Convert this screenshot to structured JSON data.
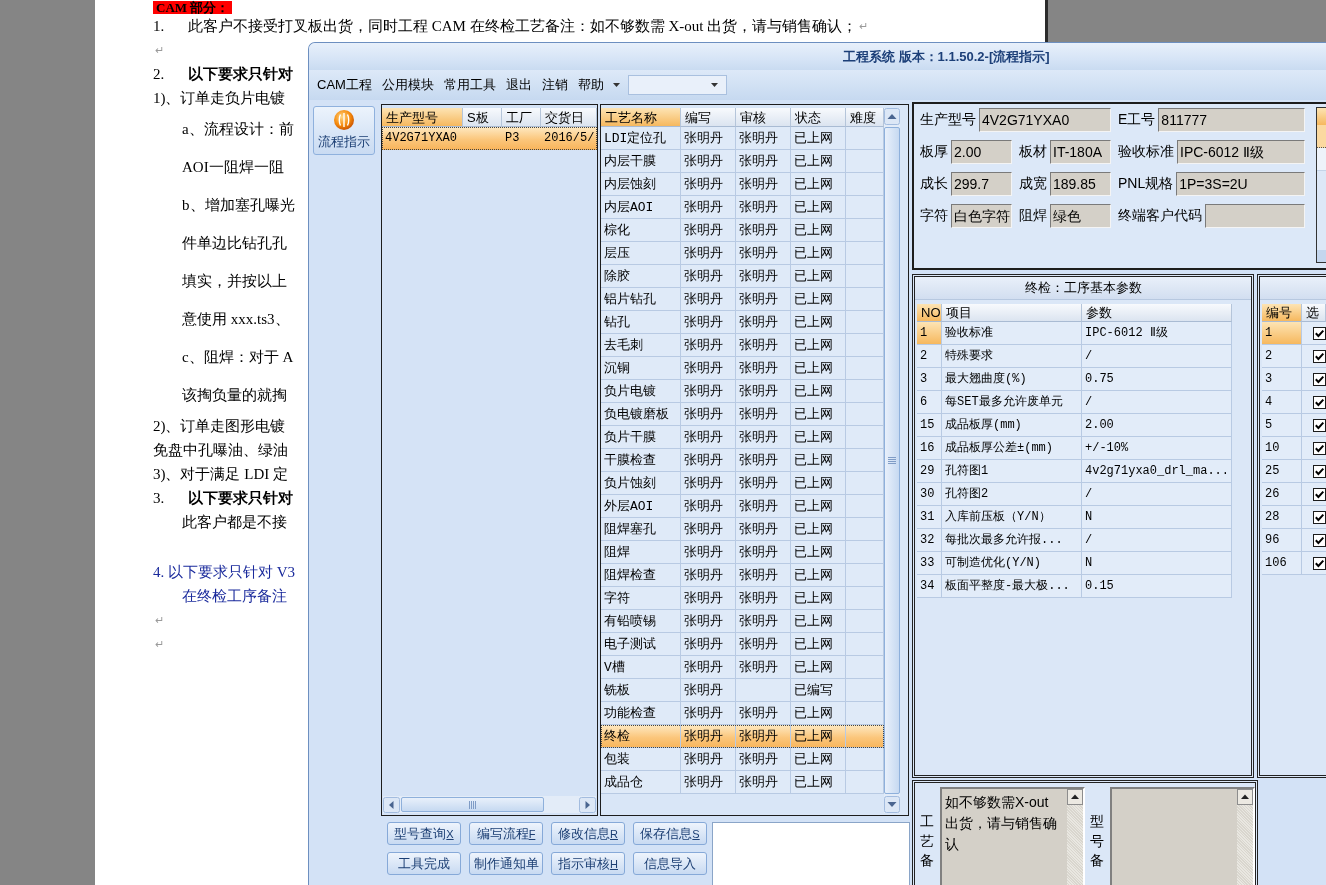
{
  "document": {
    "lines": [
      {
        "kind": "heading",
        "text": "CAM 部分："
      },
      {
        "kind": "item",
        "number": "1.",
        "text": "此客户不接受打叉板出货，同时工程 CAM 在终检工艺备注：如不够数需 X-out 出货，请与销售确认；",
        "bold": false,
        "mark": "↵"
      },
      {
        "kind": "mark",
        "mark": "↵"
      },
      {
        "kind": "item",
        "number": "2.",
        "text": "以下要求只针对",
        "bold": true
      },
      {
        "kind": "line",
        "text": "1)、订单走负片电镀"
      },
      {
        "kind": "indent",
        "text": "a、流程设计：前"
      },
      {
        "kind": "indent",
        "text": "AOI一阻焊一阻"
      },
      {
        "kind": "indent",
        "text": "b、增加塞孔曝光"
      },
      {
        "kind": "indent",
        "text": "件单边比钻孔孔"
      },
      {
        "kind": "indent",
        "text": "填实，并按以上"
      },
      {
        "kind": "indent",
        "text": "意使用 xxx.ts3、"
      },
      {
        "kind": "indent",
        "text": "c、阻焊：对于 A"
      },
      {
        "kind": "indent",
        "text": "该掏负量的就掏"
      },
      {
        "kind": "line",
        "text": "2)、订单走图形电镀"
      },
      {
        "kind": "line",
        "text": "免盘中孔曝油、绿油"
      },
      {
        "kind": "line",
        "text": "3)、对于满足 LDI 定"
      },
      {
        "kind": "item",
        "number": "3.",
        "text": "以下要求只针对",
        "bold": true
      },
      {
        "kind": "indent-tight",
        "text": "此客户都是不接"
      },
      {
        "kind": "line-spaced",
        "text": "4. 以下要求只针对 V3",
        "color": "#1a2a9c"
      },
      {
        "kind": "indent-tight",
        "text": "在终检工序备注",
        "color": "#1a2a9c"
      },
      {
        "kind": "mark",
        "mark": "↵"
      },
      {
        "kind": "mark",
        "mark": "↵"
      }
    ]
  },
  "window": {
    "title": "工程系统 版本：1.1.50.2-[流程指示]"
  },
  "menu": {
    "items": [
      "CAM工程",
      "公用模块",
      "常用工具",
      "退出",
      "注销",
      "帮助"
    ]
  },
  "sidebar": {
    "buttons": [
      {
        "label": "流程指示"
      }
    ]
  },
  "orders": {
    "columns": [
      {
        "label": "生产型号",
        "selected": true
      },
      {
        "label": "S板",
        "selected": false
      },
      {
        "label": "工厂",
        "selected": false
      },
      {
        "label": "交货日",
        "selected": false
      }
    ],
    "rows": [
      {
        "model": "4V2G71YXA0",
        "factory": "P3",
        "delivery_date": "2016/5/",
        "selected": true
      }
    ]
  },
  "processes": {
    "columns": [
      {
        "label": "工艺名称",
        "selected": true
      },
      {
        "label": "编写",
        "selected": false
      },
      {
        "label": "审核",
        "selected": false
      },
      {
        "label": "状态",
        "selected": false
      },
      {
        "label": "难度",
        "selected": false
      }
    ],
    "rows": [
      {
        "name": "LDI定位孔",
        "writer": "张明丹",
        "reviewer": "张明丹",
        "status": "已上网",
        "selected": false
      },
      {
        "name": "内层干膜",
        "writer": "张明丹",
        "reviewer": "张明丹",
        "status": "已上网",
        "selected": false
      },
      {
        "name": "内层蚀刻",
        "writer": "张明丹",
        "reviewer": "张明丹",
        "status": "已上网",
        "selected": false
      },
      {
        "name": "内层AOI",
        "writer": "张明丹",
        "reviewer": "张明丹",
        "status": "已上网",
        "selected": false
      },
      {
        "name": "棕化",
        "writer": "张明丹",
        "reviewer": "张明丹",
        "status": "已上网",
        "selected": false
      },
      {
        "name": "层压",
        "writer": "张明丹",
        "reviewer": "张明丹",
        "status": "已上网",
        "selected": false
      },
      {
        "name": "除胶",
        "writer": "张明丹",
        "reviewer": "张明丹",
        "status": "已上网",
        "selected": false
      },
      {
        "name": "铝片钻孔",
        "writer": "张明丹",
        "reviewer": "张明丹",
        "status": "已上网",
        "selected": false
      },
      {
        "name": "钻孔",
        "writer": "张明丹",
        "reviewer": "张明丹",
        "status": "已上网",
        "selected": false
      },
      {
        "name": "去毛刺",
        "writer": "张明丹",
        "reviewer": "张明丹",
        "status": "已上网",
        "selected": false
      },
      {
        "name": "沉铜",
        "writer": "张明丹",
        "reviewer": "张明丹",
        "status": "已上网",
        "selected": false
      },
      {
        "name": "负片电镀",
        "writer": "张明丹",
        "reviewer": "张明丹",
        "status": "已上网",
        "selected": false
      },
      {
        "name": "负电镀磨板",
        "writer": "张明丹",
        "reviewer": "张明丹",
        "status": "已上网",
        "selected": false
      },
      {
        "name": "负片干膜",
        "writer": "张明丹",
        "reviewer": "张明丹",
        "status": "已上网",
        "selected": false
      },
      {
        "name": "干膜检查",
        "writer": "张明丹",
        "reviewer": "张明丹",
        "status": "已上网",
        "selected": false
      },
      {
        "name": "负片蚀刻",
        "writer": "张明丹",
        "reviewer": "张明丹",
        "status": "已上网",
        "selected": false
      },
      {
        "name": "外层AOI",
        "writer": "张明丹",
        "reviewer": "张明丹",
        "status": "已上网",
        "selected": false
      },
      {
        "name": "阻焊塞孔",
        "writer": "张明丹",
        "reviewer": "张明丹",
        "status": "已上网",
        "selected": false
      },
      {
        "name": "阻焊",
        "writer": "张明丹",
        "reviewer": "张明丹",
        "status": "已上网",
        "selected": false
      },
      {
        "name": "阻焊检查",
        "writer": "张明丹",
        "reviewer": "张明丹",
        "status": "已上网",
        "selected": false
      },
      {
        "name": "字符",
        "writer": "张明丹",
        "reviewer": "张明丹",
        "status": "已上网",
        "selected": false
      },
      {
        "name": "有铅喷锡",
        "writer": "张明丹",
        "reviewer": "张明丹",
        "status": "已上网",
        "selected": false
      },
      {
        "name": "电子测试",
        "writer": "张明丹",
        "reviewer": "张明丹",
        "status": "已上网",
        "selected": false
      },
      {
        "name": "V槽",
        "writer": "张明丹",
        "reviewer": "张明丹",
        "status": "已上网",
        "selected": false
      },
      {
        "name": "铣板",
        "writer": "张明丹",
        "status": "已编写",
        "selected": false
      },
      {
        "name": "功能检查",
        "writer": "张明丹",
        "reviewer": "张明丹",
        "status": "已上网",
        "selected": false
      },
      {
        "name": "终检",
        "writer": "张明丹",
        "reviewer": "张明丹",
        "status": "已上网",
        "selected": true
      },
      {
        "name": "包装",
        "writer": "张明丹",
        "reviewer": "张明丹",
        "status": "已上网",
        "selected": false
      },
      {
        "name": "成品仓",
        "writer": "张明丹",
        "reviewer": "张明丹",
        "status": "已上网",
        "selected": false
      }
    ]
  },
  "buttons": [
    {
      "label": "型号查询",
      "shortcut": "X"
    },
    {
      "label": "编写流程",
      "shortcut": "F"
    },
    {
      "label": "修改信息",
      "shortcut": "R"
    },
    {
      "label": "保存信息",
      "shortcut": "S"
    },
    {
      "label": "工具完成"
    },
    {
      "label": "制作通知单"
    },
    {
      "label": "指示审核",
      "shortcut": "H"
    },
    {
      "label": "信息导入"
    }
  ],
  "info": {
    "rows": [
      [
        {
          "label": "生产型号",
          "value": "4V2G71YXA0"
        },
        "",
        {
          "label": "E工号",
          "value": "811777"
        }
      ],
      [
        {
          "label": "板厚",
          "value": "2.00"
        },
        {
          "label": "板材",
          "value": "IT-180A"
        },
        {
          "label": "验收标准",
          "value": "IPC-6012 Ⅱ级"
        }
      ],
      [
        {
          "label": "成长",
          "value": "299.7"
        },
        {
          "label": "成宽",
          "value": "189.85"
        },
        {
          "label": "PNL规格",
          "value": "1P=3S=2U"
        }
      ],
      [
        {
          "label": "字符",
          "value": "白色字符"
        },
        {
          "label": "阻焊",
          "value": "绿色"
        },
        {
          "label": "终端客户代码"
        }
      ]
    ]
  },
  "params": {
    "title": "终检：工序基本参数",
    "columns": [
      {
        "label": "NO",
        "selected": true
      },
      {
        "label": "项目",
        "selected": false
      },
      {
        "label": "参数",
        "selected": false
      }
    ],
    "rows": [
      {
        "no": "1",
        "item": "验收标准",
        "value": "IPC-6012 Ⅱ级",
        "selected": true
      },
      {
        "no": "2",
        "item": "特殊要求",
        "value": "/",
        "selected": false
      },
      {
        "no": "3",
        "item": "最大翘曲度(%)",
        "value": "0.75",
        "selected": false
      },
      {
        "no": "6",
        "item": "每SET最多允许废单元",
        "value": "/",
        "selected": false
      },
      {
        "no": "15",
        "item": "成品板厚(mm)",
        "value": "2.00",
        "selected": false
      },
      {
        "no": "16",
        "item": "成品板厚公差±(mm)",
        "value": "+/-10%",
        "selected": false
      },
      {
        "no": "29",
        "item": "孔符图1",
        "value": "4v2g71yxa0_drl_ma...",
        "selected": false
      },
      {
        "no": "30",
        "item": "孔符图2",
        "value": "/",
        "selected": false
      },
      {
        "no": "31",
        "item": "入库前压板（Y/N）",
        "value": "N",
        "selected": false
      },
      {
        "no": "32",
        "item": "每批次最多允许报...",
        "value": "/",
        "selected": false
      },
      {
        "no": "33",
        "item": "可制造优化(Y/N)",
        "value": "N",
        "selected": false
      },
      {
        "no": "34",
        "item": "板面平整度-最大极...",
        "value": "0.15",
        "selected": false
      }
    ]
  },
  "checklist": {
    "columns": [
      {
        "label": "编号",
        "selected": true
      },
      {
        "label": "选",
        "selected": false
      }
    ],
    "rows": [
      {
        "no": "1",
        "checked": true,
        "selected": true
      },
      {
        "no": "2",
        "checked": true,
        "selected": false
      },
      {
        "no": "3",
        "checked": true,
        "selected": false
      },
      {
        "no": "4",
        "checked": true,
        "selected": false
      },
      {
        "no": "5",
        "checked": true,
        "selected": false
      },
      {
        "no": "10",
        "checked": true,
        "selected": false
      },
      {
        "no": "25",
        "checked": true,
        "selected": false
      },
      {
        "no": "26",
        "checked": true,
        "selected": false
      },
      {
        "no": "28",
        "checked": true,
        "selected": false
      },
      {
        "no": "96",
        "checked": true,
        "selected": false
      },
      {
        "no": "106",
        "checked": true,
        "selected": false
      }
    ]
  },
  "notes": [
    {
      "label": "工艺备",
      "text": "如不够数需X-out出货，请与销售确认"
    },
    {
      "label": "型号备"
    }
  ]
}
